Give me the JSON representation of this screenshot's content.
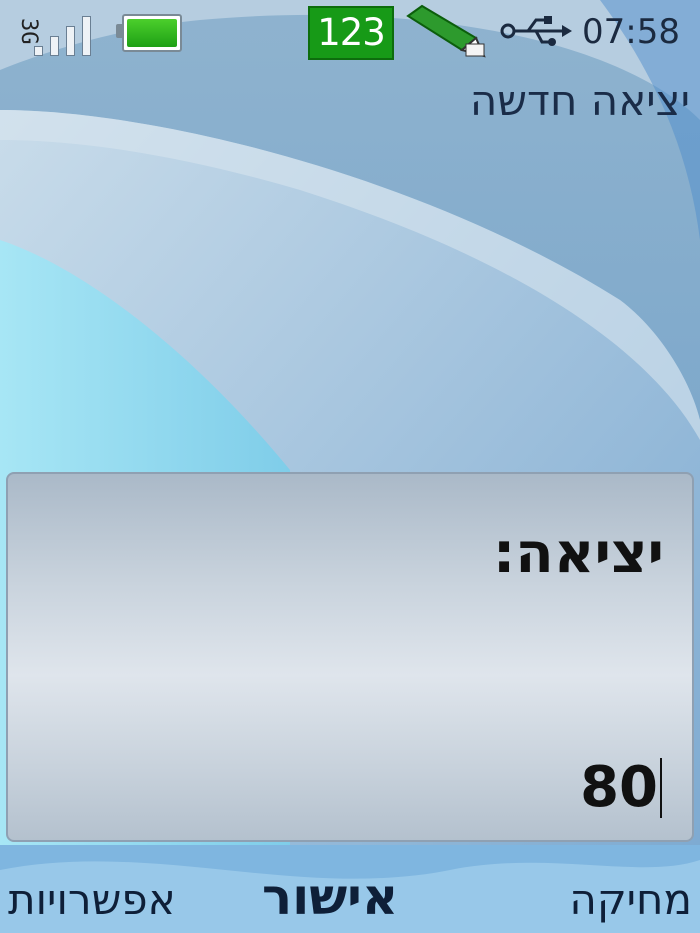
{
  "status": {
    "network": "3G",
    "input_mode": "123",
    "time": "07:58"
  },
  "page": {
    "title": "יציאה חדשה"
  },
  "dialog": {
    "label": "יציאה:",
    "value": "80"
  },
  "softkeys": {
    "left": "אפשרויות",
    "middle": "אישור",
    "right": "מחיקה"
  },
  "colors": {
    "battery": "#1ea015",
    "input_mode_bg": "#179a17",
    "text_dark": "#1a2c48"
  }
}
